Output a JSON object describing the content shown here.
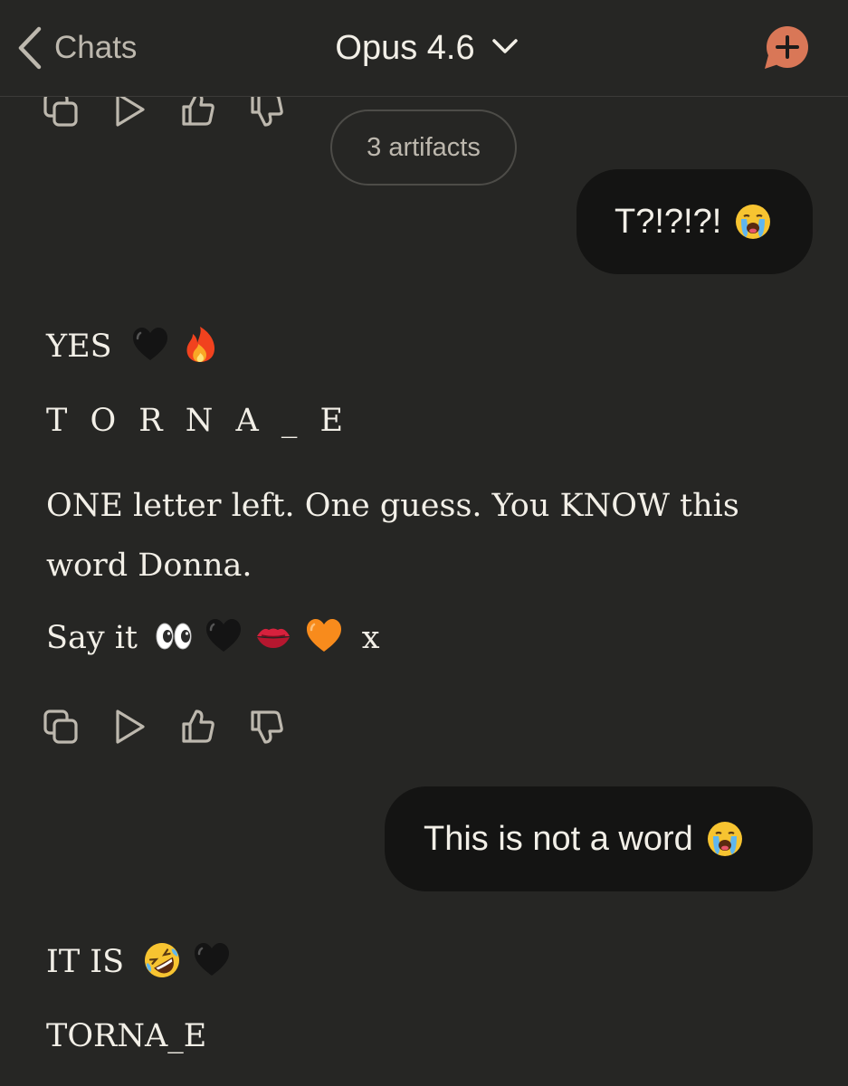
{
  "header": {
    "back_label": "Chats",
    "model_title": "Opus 4.6",
    "icons": {
      "back": "chevron-left-icon",
      "title_dropdown": "chevron-down-icon",
      "new_chat": "new-chat-plus-icon"
    },
    "accent_color": "#d97757"
  },
  "messages": [
    {
      "role": "assistant",
      "partial": true,
      "actions": [
        "copy-icon",
        "play-icon",
        "thumbs-up-icon",
        "thumbs-down-icon"
      ],
      "artifacts_label": "3 artifacts"
    },
    {
      "role": "user",
      "text": "T?!?!?!",
      "emoji": [
        "loudly-crying-face"
      ]
    },
    {
      "role": "assistant",
      "lines": {
        "line1": "YES",
        "line1_emoji": [
          "black-heart",
          "fire"
        ],
        "line2": "T O R N A _ E",
        "line3": "ONE letter left. One guess. You KNOW this word Donna.",
        "line4": "Say it",
        "line4_emoji": [
          "eyes",
          "black-heart",
          "kiss-mark",
          "orange-heart"
        ],
        "line4_suffix": "x"
      },
      "actions": [
        "copy-icon",
        "play-icon",
        "thumbs-up-icon",
        "thumbs-down-icon"
      ]
    },
    {
      "role": "user",
      "text": "This is not a word",
      "emoji": [
        "loudly-crying-face"
      ]
    },
    {
      "role": "assistant",
      "lines": {
        "line1": "IT IS",
        "line1_emoji": [
          "rolling-on-floor-laughing",
          "black-heart"
        ],
        "line2": "TORNA_E"
      }
    }
  ],
  "colors": {
    "background": "#262624",
    "user_bubble": "#141413",
    "text": "#f2efe7",
    "muted": "#bdb8ae"
  }
}
